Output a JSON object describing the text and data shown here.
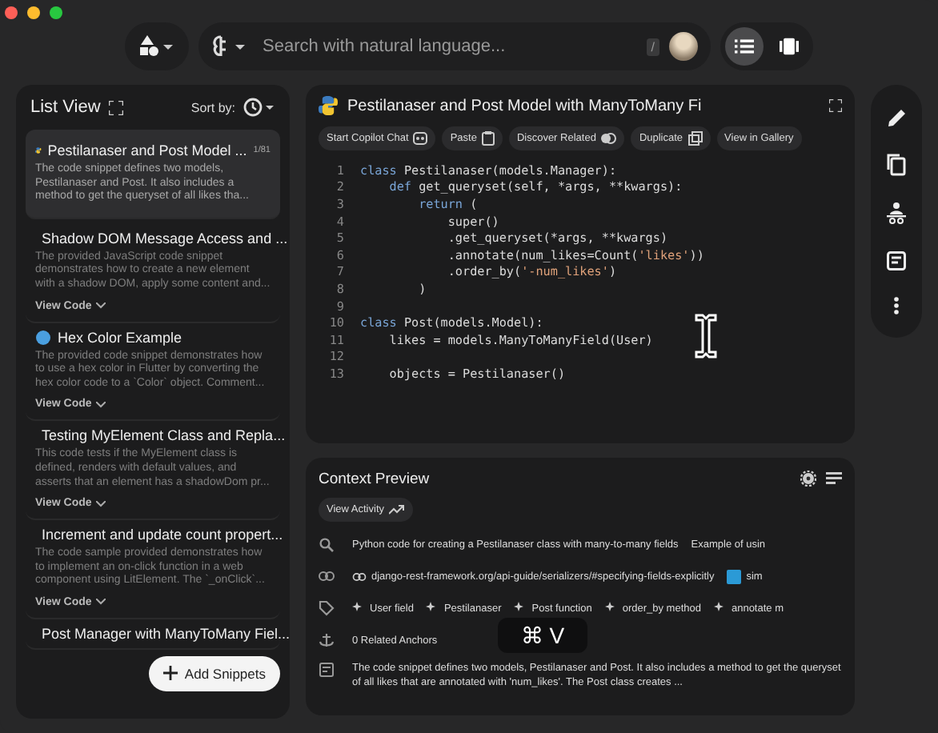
{
  "search": {
    "placeholder": "Search with natural language...",
    "shortcut": "/"
  },
  "view_toggle": [
    {
      "kind": "list",
      "selected": true
    },
    {
      "kind": "carousel",
      "selected": false
    }
  ],
  "list_view": {
    "title": "List View",
    "sort_label": "Sort by:",
    "items": [
      {
        "kind": "python",
        "title": "Pestilanaser and Post Model ...",
        "badge": "1/81",
        "selected": true,
        "description": "The code snippet defines two models, Pestilanaser and Post. It also includes a method to get the queryset of all likes tha..."
      },
      {
        "kind": "js",
        "title": "Shadow DOM Message Access and ...",
        "selected": false,
        "description": "The provided JavaScript code snippet demonstrates how to create a new element with a shadow DOM, apply some content and...",
        "action": "View Code"
      },
      {
        "kind": "dart",
        "title": "Hex Color Example",
        "selected": false,
        "description": "The provided code snippet demonstrates how to use a hex color in Flutter by converting the hex color code to a `Color` object. Comment...",
        "action": "View Code"
      },
      {
        "kind": "ts",
        "title": "Testing MyElement Class and Repla...",
        "selected": false,
        "description": "This code tests if the MyElement class is defined, renders with default values, and asserts that an element has a shadowDom pr...",
        "action": "View Code"
      },
      {
        "kind": "js",
        "title": "Increment and update count propert...",
        "selected": false,
        "description": "The code sample provided demonstrates how to implement an on-click function in a web component using LitElement. The `_onClick`...",
        "action": "View Code"
      },
      {
        "kind": "python",
        "title": "Post Manager with ManyToMany Fiel...",
        "selected": false
      }
    ],
    "add_button": "Add Snippets"
  },
  "snippet": {
    "title": "Pestilanaser and Post Model with ManyToMany Fi",
    "actions": [
      {
        "label": "Start Copilot Chat",
        "kind": "chat"
      },
      {
        "label": "Paste",
        "kind": "paste"
      },
      {
        "label": "Discover Related",
        "kind": "related"
      },
      {
        "label": "Duplicate",
        "kind": "duplicate"
      },
      {
        "label": "View in Gallery",
        "kind": "gallery"
      }
    ],
    "lines": [
      {
        "number": "1",
        "tokens": [
          {
            "t": "class ",
            "kind": "kw"
          },
          {
            "t": "Pestilanaser(models.Manager):",
            "kind": "plain"
          }
        ]
      },
      {
        "number": "2",
        "tokens": [
          {
            "t": "    def ",
            "kind": "kw"
          },
          {
            "t": "get_queryset(self, *args, **kwargs):",
            "kind": "plain"
          }
        ]
      },
      {
        "number": "3",
        "tokens": [
          {
            "t": "        return ",
            "kind": "kw"
          },
          {
            "t": "(",
            "kind": "plain"
          }
        ]
      },
      {
        "number": "4",
        "tokens": [
          {
            "t": "            super()",
            "kind": "plain"
          }
        ]
      },
      {
        "number": "5",
        "tokens": [
          {
            "t": "            .get_queryset(*args, **kwargs)",
            "kind": "plain"
          }
        ]
      },
      {
        "number": "6",
        "tokens": [
          {
            "t": "            .annotate(num_likes=Count(",
            "kind": "plain"
          },
          {
            "t": "'likes'",
            "kind": "str"
          },
          {
            "t": "))",
            "kind": "plain"
          }
        ]
      },
      {
        "number": "7",
        "tokens": [
          {
            "t": "            .order_by(",
            "kind": "plain"
          },
          {
            "t": "'-num_likes'",
            "kind": "str"
          },
          {
            "t": ")",
            "kind": "plain"
          }
        ]
      },
      {
        "number": "8",
        "tokens": [
          {
            "t": "        )",
            "kind": "plain"
          }
        ]
      },
      {
        "number": "9"
      },
      {
        "number": "10",
        "tokens": [
          {
            "t": "class ",
            "kind": "kw"
          },
          {
            "t": "Post(models.Model):",
            "kind": "plain"
          }
        ]
      },
      {
        "number": "11",
        "tokens": [
          {
            "t": "    likes = models.ManyToManyField(User)",
            "kind": "plain"
          }
        ]
      },
      {
        "number": "12"
      },
      {
        "number": "13",
        "tokens": [
          {
            "t": "    objects = Pestilanaser()",
            "kind": "plain"
          }
        ]
      }
    ]
  },
  "context_preview": {
    "title": "Context Preview",
    "activity_button": "View Activity",
    "searches": [
      "Python code for creating a Pestilanaser class with many-to-many fields",
      "Example of usin"
    ],
    "links": [
      "django-rest-framework.org/api-guide/serializers/#specifying-fields-explicitly",
      "sim"
    ],
    "tags": [
      "User field",
      "Pestilanaser",
      "Post function",
      "order_by method",
      "annotate m"
    ],
    "anchors": "0 Related Anchors",
    "summary": "The code snippet defines two models, Pestilanaser and Post. It also includes a method to get the queryset of all likes that are annotated with 'num_likes'. The Post class creates ..."
  },
  "shortcut_overlay": {
    "keys": "⌘ V"
  }
}
